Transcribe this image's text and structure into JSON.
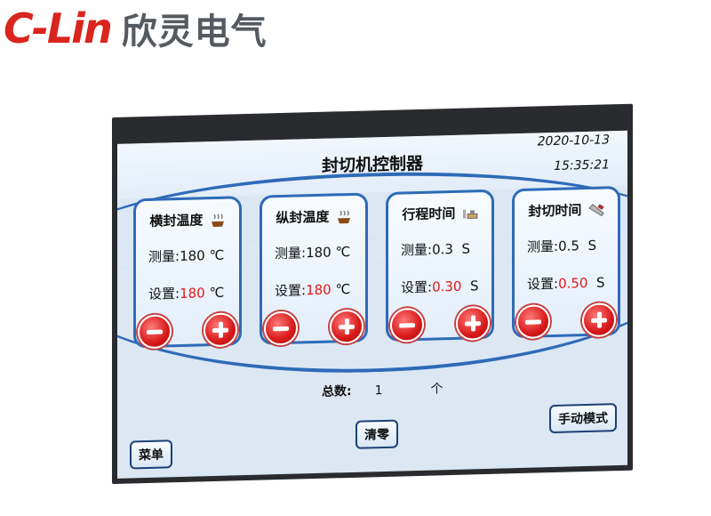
{
  "brand": {
    "logo_c": "C",
    "logo_dash": "-",
    "logo_rest": "Lin",
    "name": "欣灵电气",
    "colors": {
      "logo_red": "#d9251d",
      "logo_blue": "#1e5fae",
      "name_gray": "#555a60"
    }
  },
  "screen": {
    "title": "封切机控制器",
    "date": "2020-10-13",
    "time": "15:35:21"
  },
  "cards": [
    {
      "title": "横封温度",
      "icon": "heat-icon",
      "measure_label": "测量:",
      "measure_value": "180 ℃",
      "set_label": "设置:",
      "set_value": "180",
      "unit": "℃"
    },
    {
      "title": "纵封温度",
      "icon": "heat-icon",
      "measure_label": "测量:",
      "measure_value": "180 ℃",
      "set_label": "设置:",
      "set_value": "180",
      "unit": "℃"
    },
    {
      "title": "行程时间",
      "icon": "travel-icon",
      "measure_label": "测量:",
      "measure_value": "0.3  S",
      "set_label": "设置:",
      "set_value": "0.30",
      "unit": "S"
    },
    {
      "title": "封切时间",
      "icon": "cutter-icon",
      "measure_label": "测量:",
      "measure_value": "0.5  S",
      "set_label": "设置:",
      "set_value": "0.50",
      "unit": "S"
    }
  ],
  "footer": {
    "count_label": "总数:",
    "count_value": "1",
    "count_unit": "个",
    "menu_label": "菜单",
    "clear_label": "清零",
    "manual_label": "手动模式"
  },
  "colors": {
    "accent_blue": "#2f6ab8",
    "set_red": "#e01818",
    "button_red": "#d81919"
  }
}
